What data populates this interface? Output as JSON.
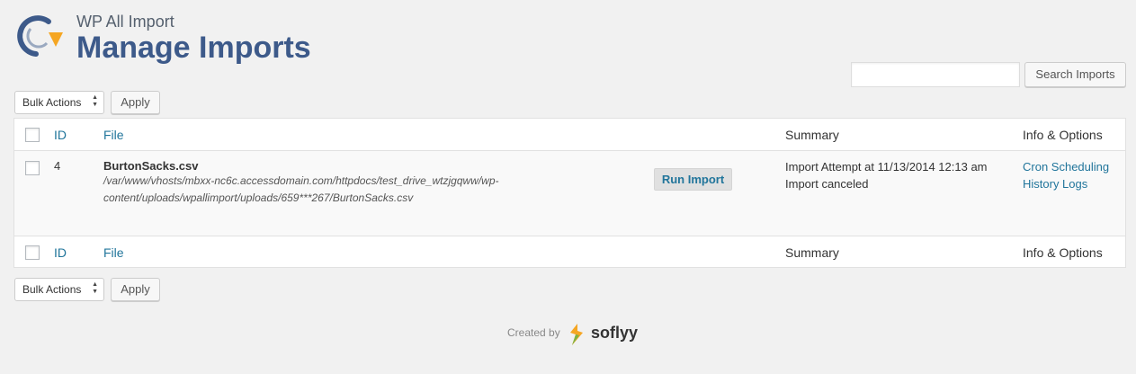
{
  "header": {
    "plugin_name": "WP All Import",
    "page_title": "Manage Imports",
    "logo_icon": "wp-all-import-logo-icon"
  },
  "search": {
    "placeholder": "",
    "button_label": "Search Imports"
  },
  "bulk_top": {
    "select_value": "Bulk Actions",
    "apply_label": "Apply"
  },
  "bulk_bottom": {
    "select_value": "Bulk Actions",
    "apply_label": "Apply"
  },
  "table": {
    "columns": [
      "ID",
      "File",
      "Summary",
      "Info & Options"
    ],
    "rows": [
      {
        "id": "4",
        "file_name": "BurtonSacks.csv",
        "file_path_line1": "/var/www/vhosts/mbxx-nc6c.accessdomain.com/httpdocs/test_drive_wtzjgqww/wp-",
        "file_path_line2": "content/uploads/wpallimport/uploads/659***267/BurtonSacks.csv",
        "action_label": "Run Import",
        "summary_line1": "Import Attempt at 11/13/2014 12:13 am",
        "summary_line2": "Import canceled",
        "links": [
          "Cron Scheduling",
          "History Logs"
        ]
      }
    ]
  },
  "footer": {
    "created_by": "Created by",
    "brand": "soflyy",
    "brand_icon": "soflyy-logo-icon"
  },
  "colors": {
    "background": "#f1f1f1",
    "title": "#3d5a8a",
    "link": "#21759b"
  }
}
